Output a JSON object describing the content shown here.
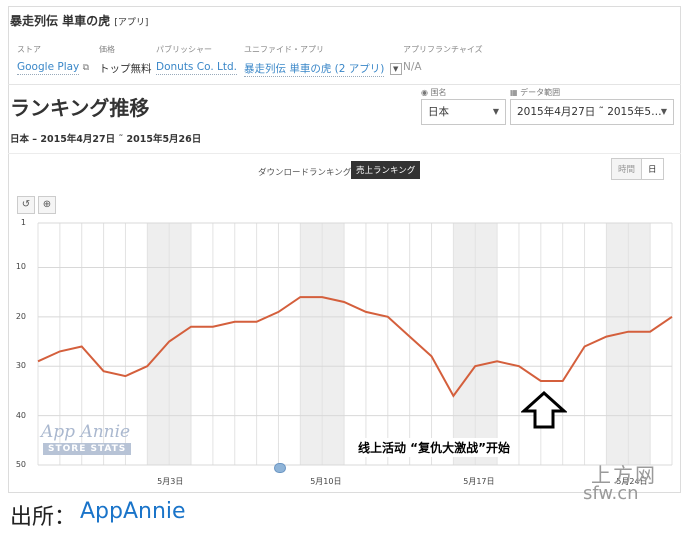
{
  "app": {
    "title": "暴走列伝 単車の虎",
    "title_tag": "[アプリ]"
  },
  "meta": {
    "store": {
      "label": "ストア",
      "value": "Google Play"
    },
    "price": {
      "label": "価格",
      "value": "トップ無料"
    },
    "publisher": {
      "label": "パブリッシャー",
      "value": "Donuts Co. Ltd."
    },
    "unified": {
      "label": "ユニファイド・アプリ",
      "value": "暴走列伝 単車の虎 (2 アプリ)"
    },
    "franchise": {
      "label": "アプリフランチャイズ",
      "value": "N/A"
    }
  },
  "heading": {
    "title": "ランキング推移",
    "subtitle": "日本 – 2015年4月27日 ˜ 2015年5月26日"
  },
  "filters": {
    "country_label": "国名",
    "country_value": "日本",
    "range_label": "データ範囲",
    "range_value": "2015年4月27日 ˜ 2015年5…"
  },
  "toggle": {
    "download": "ダウンロードランキング",
    "revenue": "売上ランキング"
  },
  "granularity": {
    "hour": "時間",
    "day": "日"
  },
  "tools": {
    "reset_icon": "undo-icon",
    "zoom_icon": "zoom-icon",
    "reset_glyph": "↺",
    "zoom_glyph": "⊕"
  },
  "chart_data": {
    "type": "line",
    "y_reversed": true,
    "ylim": [
      1,
      50
    ],
    "yticks": [
      "1",
      "10",
      "20",
      "30",
      "40",
      "50"
    ],
    "xtick_labels": [
      "5月3日",
      "5月10日",
      "5月17日",
      "5月24日"
    ],
    "x": [
      "2015-04-27",
      "2015-04-28",
      "2015-04-29",
      "2015-04-30",
      "2015-05-01",
      "2015-05-02",
      "2015-05-03",
      "2015-05-04",
      "2015-05-05",
      "2015-05-06",
      "2015-05-07",
      "2015-05-08",
      "2015-05-09",
      "2015-05-10",
      "2015-05-11",
      "2015-05-12",
      "2015-05-13",
      "2015-05-14",
      "2015-05-15",
      "2015-05-16",
      "2015-05-17",
      "2015-05-18",
      "2015-05-19",
      "2015-05-20",
      "2015-05-21",
      "2015-05-22",
      "2015-05-23",
      "2015-05-24",
      "2015-05-25",
      "2015-05-26"
    ],
    "series": [
      {
        "color": "#d45f3c",
        "values": [
          29,
          27,
          26,
          31,
          32,
          30,
          25,
          22,
          22,
          21,
          21,
          19,
          16,
          16,
          17,
          19,
          20,
          24,
          28,
          36,
          30,
          29,
          30,
          33,
          33,
          26,
          24,
          23,
          23,
          20
        ]
      }
    ],
    "weekend_shading": true,
    "grid": true
  },
  "watermark": {
    "text": "App Annie",
    "sub": "STORE STATS"
  },
  "annotation": {
    "text": "线上活动 “复仇大激战”开始",
    "arrow_icon": "up-arrow-icon"
  },
  "site_watermark": {
    "line1": "上方网",
    "line2": "sfw.cn"
  },
  "footer": {
    "label": "出所：",
    "link": "AppAnnie"
  }
}
